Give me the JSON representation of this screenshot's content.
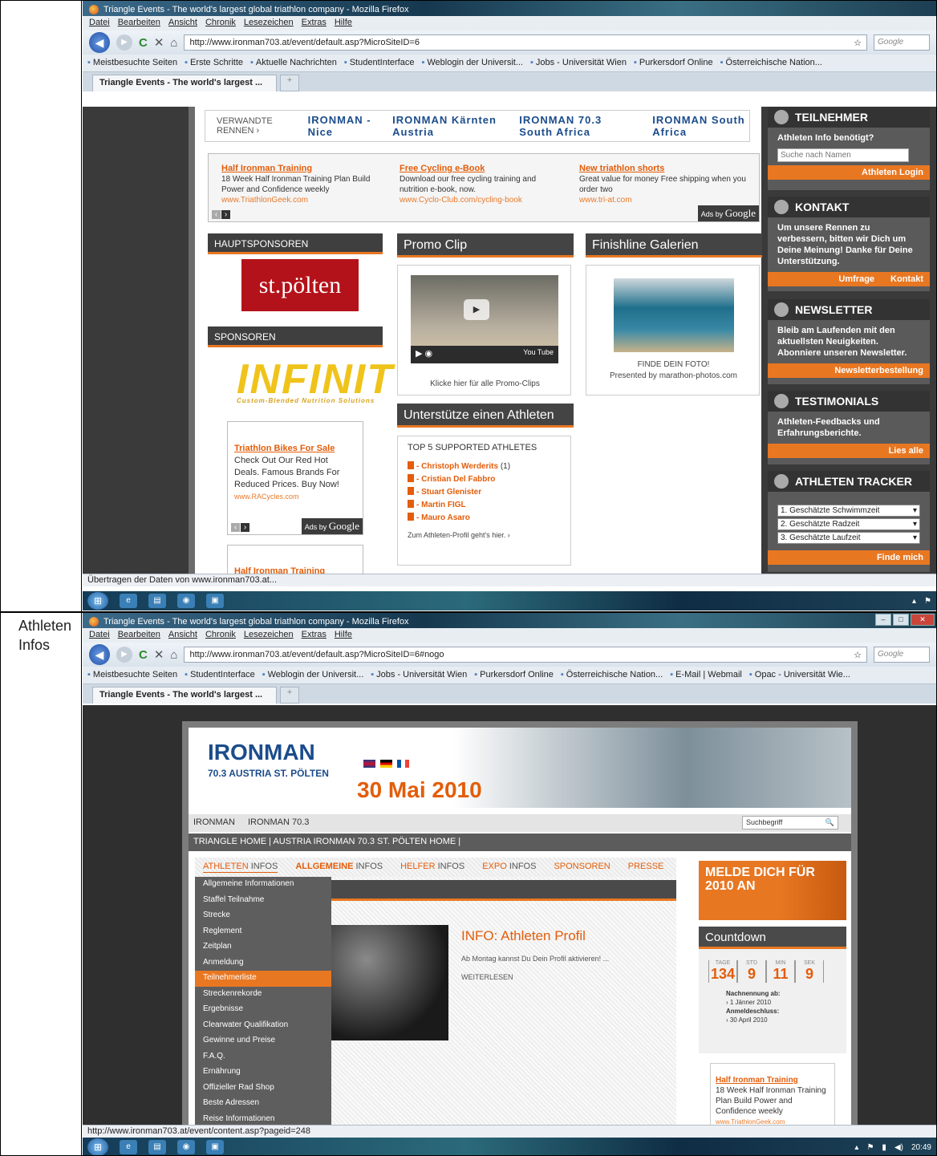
{
  "row_labels": [
    "",
    "Athleten Infos"
  ],
  "shot1": {
    "title": "Triangle Events - The world's largest global triathlon company - Mozilla Firefox",
    "menu": [
      "Datei",
      "Bearbeiten",
      "Ansicht",
      "Chronik",
      "Lesezeichen",
      "Extras",
      "Hilfe"
    ],
    "url": "http://www.ironman703.at/event/default.asp?MicroSiteID=6",
    "search_placeholder": "Google",
    "bookmarks": [
      "Meistbesuchte Seiten",
      "Erste Schritte",
      "Aktuelle Nachrichten",
      "StudentInterface",
      "Weblogin der Universit...",
      "Jobs - Universität Wien",
      "Purkersdorf Online",
      "Österreichische Nation..."
    ],
    "tab": "Triangle Events - The world's largest ...",
    "status": "Übertragen der Daten von www.ironman703.at...",
    "verwandte": "VERWANDTE RENNEN ›",
    "verwandte_logos": [
      "IRONMAN - Nice",
      "IRONMAN Kärnten Austria",
      "IRONMAN 70.3 South Africa",
      "IRONMAN South Africa"
    ],
    "ads": [
      {
        "h": "Half Ironman Training",
        "t": "18 Week Half Ironman Training Plan Build Power and Confidence weekly",
        "u": "www.TriathlonGeek.com"
      },
      {
        "h": "Free Cycling e-Book",
        "t": "Download our free cycling training and nutrition e-book, now.",
        "u": "www.Cyclo-Club.com/cycling-book"
      },
      {
        "h": "New triathlon shorts",
        "t": "Great value for money Free shipping when you order two",
        "u": "www.tri-at.com"
      }
    ],
    "adsby": "Ads by",
    "google": "Google",
    "hauptsponsoren": "HAUPTSPONSOREN",
    "stpoelten": "st.pölten",
    "sponsoren": "SPONSOREN",
    "infinit": "INFINIT",
    "infinit_sub": "Custom-Blended Nutrition Solutions",
    "ad2": {
      "h": "Triathlon Bikes For Sale",
      "t": "Check Out Our Red Hot Deals. Famous Brands For Reduced Prices. Buy Now!",
      "u": "www.RACycles.com"
    },
    "ad3_h": "Half Ironman Training",
    "promo_title": "Promo Clip",
    "promo_caption": "Klicke hier für alle Promo-Clips",
    "youtube": "You Tube",
    "fin_title": "Finishline Galerien",
    "fin_caption1": "FINDE DEIN FOTO!",
    "fin_caption2": "Presented by marathon-photos.com",
    "support_title": "Unterstütze einen Athleten",
    "support_sub": "TOP 5 SUPPORTED ATHLETES",
    "athletes": [
      {
        "name": "- Christoph Werderits",
        "count": "(1)"
      },
      {
        "name": "- Cristian Del Fabbro",
        "count": ""
      },
      {
        "name": "- Stuart Glenister",
        "count": ""
      },
      {
        "name": "- Martin FIGL",
        "count": ""
      },
      {
        "name": "- Mauro Asaro",
        "count": ""
      }
    ],
    "support_more": "Zum Athleten-Profil geht's hier. ›",
    "teilnehmer": {
      "h": "TEILNEHMER",
      "t": "Athleten Info benötigt?",
      "placeholder": "Suche nach Namen",
      "btn": "Athleten Login"
    },
    "kontakt": {
      "h": "KONTAKT",
      "t": "Um unsere Rennen zu verbessern, bitten wir Dich um Deine Meinung! Danke für Deine Unterstützung.",
      "b1": "Umfrage",
      "b2": "Kontakt"
    },
    "newsletter": {
      "h": "NEWSLETTER",
      "t": "Bleib am Laufenden mit den aktuellsten Neuigkeiten. Abonniere unseren Newsletter.",
      "btn": "Newsletterbestellung"
    },
    "testimonials": {
      "h": "TESTIMONIALS",
      "t": "Athleten-Feedbacks und Erfahrungsberichte.",
      "btn": "Lies alle"
    },
    "tracker": {
      "h": "ATHLETEN TRACKER",
      "s1": "1. Geschätzte Schwimmzeit",
      "s2": "2. Geschätzte Radzeit",
      "s3": "3. Geschätzte Laufzeit",
      "btn": "Finde mich"
    }
  },
  "shot2": {
    "title": "Triangle Events - The world's largest global triathlon company - Mozilla Firefox",
    "menu": [
      "Datei",
      "Bearbeiten",
      "Ansicht",
      "Chronik",
      "Lesezeichen",
      "Extras",
      "Hilfe"
    ],
    "url": "http://www.ironman703.at/event/default.asp?MicroSiteID=6#nogo",
    "bookmarks": [
      "Meistbesuchte Seiten",
      "StudentInterface",
      "Weblogin der Universit...",
      "Jobs - Universität Wien",
      "Purkersdorf Online",
      "Österreichische Nation...",
      "E-Mail | Webmail",
      "Opac - Universität Wie..."
    ],
    "tab": "Triangle Events - The world's largest ...",
    "status": "http://www.ironman703.at/event/content.asp?pageid=248",
    "clock": "20:49",
    "logo_top": "IRONMAN",
    "logo_bottom": "70.3 AUSTRIA ST. PÖLTEN",
    "date": "30 Mai 2010",
    "nav1": [
      "IRONMAN",
      "IRONMAN 70.3"
    ],
    "suchbegriff": "Suchbegriff",
    "nav2": "TRIANGLE HOME  |  AUSTRIA IRONMAN 70.3 ST. PÖLTEN HOME  |",
    "tabs": [
      {
        "a": "ATHLETEN",
        "b": " INFOS"
      },
      {
        "a": "ALLGEMEINE",
        "b": " INFOS"
      },
      {
        "a": "HELFER",
        "b": " INFOS"
      },
      {
        "a": "EXPO",
        "b": " INFOS"
      },
      {
        "a": "SPONSOREN",
        "b": ""
      },
      {
        "a": "PRESSE",
        "b": ""
      }
    ],
    "dropdown": [
      "Allgemeine Informationen",
      "Staffel Teilnahme",
      "Strecke",
      "Reglement",
      "Zeitplan",
      "Anmeldung",
      "Teilnehmerliste",
      "Streckenrekorde",
      "Ergebnisse",
      "Clearwater Qualifikation",
      "Gewinne und Preise",
      "F.A.Q.",
      "Ernährung",
      "Offizieller Rad Shop",
      "Beste Adressen",
      "Reise Informationen"
    ],
    "info_title": "INFO: Athleten Profil",
    "info_text": "Ab Montag kannst Du Dein Profil aktivieren! ...",
    "weiter": "WEITERLESEN",
    "melde": "MELDE DICH FÜR 2010 AN",
    "countdown": "Countdown",
    "cd_labels": [
      "TAGE",
      "STD",
      "MIN",
      "SEK"
    ],
    "cd_values": [
      "134",
      "9",
      "11",
      "9"
    ],
    "nach_h": "Nachnennung ab:",
    "nach_v": "› 1 Jänner 2010",
    "anm_h": "Anmeldeschluss:",
    "anm_v": "› 30 April 2010",
    "sidead": {
      "h": "Half Ironman Training",
      "t": "18 Week Half Ironman Training Plan Build Power and Confidence weekly",
      "u": "www.TriathlonGeek.com"
    }
  },
  "colors": {
    "accent": "#e87722",
    "link": "#e35d0a",
    "dark": "#3f3f3f"
  }
}
